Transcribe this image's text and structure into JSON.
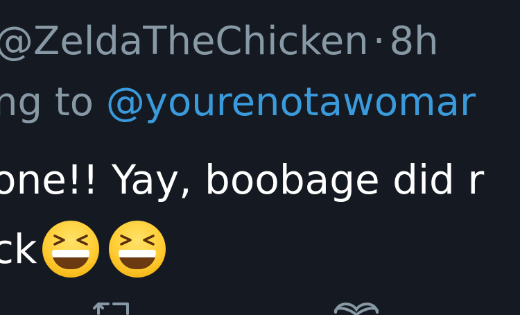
{
  "tweet": {
    "handle": "@ZeldaTheChicken",
    "separator": "·",
    "time": "8h",
    "reply_prefix": "ng to",
    "reply_mention": "@yourenotawomar",
    "body_line1": "one!! Yay, boobage did r",
    "body_line2_text": "ck",
    "body_line2_emoji": [
      "grinning-squinting-face",
      "grinning-squinting-face"
    ]
  },
  "actions": {
    "icons": [
      "retweet-icon",
      "like-icon"
    ]
  },
  "colors": {
    "background": "#151a22",
    "muted_text": "#8899a6",
    "mention": "#3a9bdc",
    "body_text": "#ffffff"
  }
}
